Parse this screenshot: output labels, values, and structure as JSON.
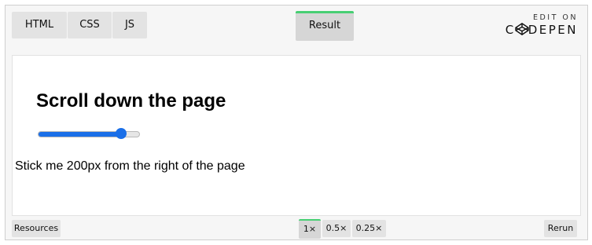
{
  "tabs": {
    "html": "HTML",
    "css": "CSS",
    "js": "JS",
    "result": "Result"
  },
  "codepen": {
    "edit_label": "EDIT ON",
    "logo_left": "C",
    "logo_right": "DEPEN"
  },
  "result": {
    "heading": "Scroll down the page",
    "slider_value_fraction": 0.82,
    "sticky_text": "Stick me 200px from the right of the page"
  },
  "bottom": {
    "resources": "Resources",
    "zoom_1x": "1×",
    "zoom_05x": "0.5×",
    "zoom_025x": "0.25×",
    "rerun": "Rerun"
  },
  "colors": {
    "accent_green": "#47cf73",
    "slider_blue": "#1a6fe8"
  }
}
